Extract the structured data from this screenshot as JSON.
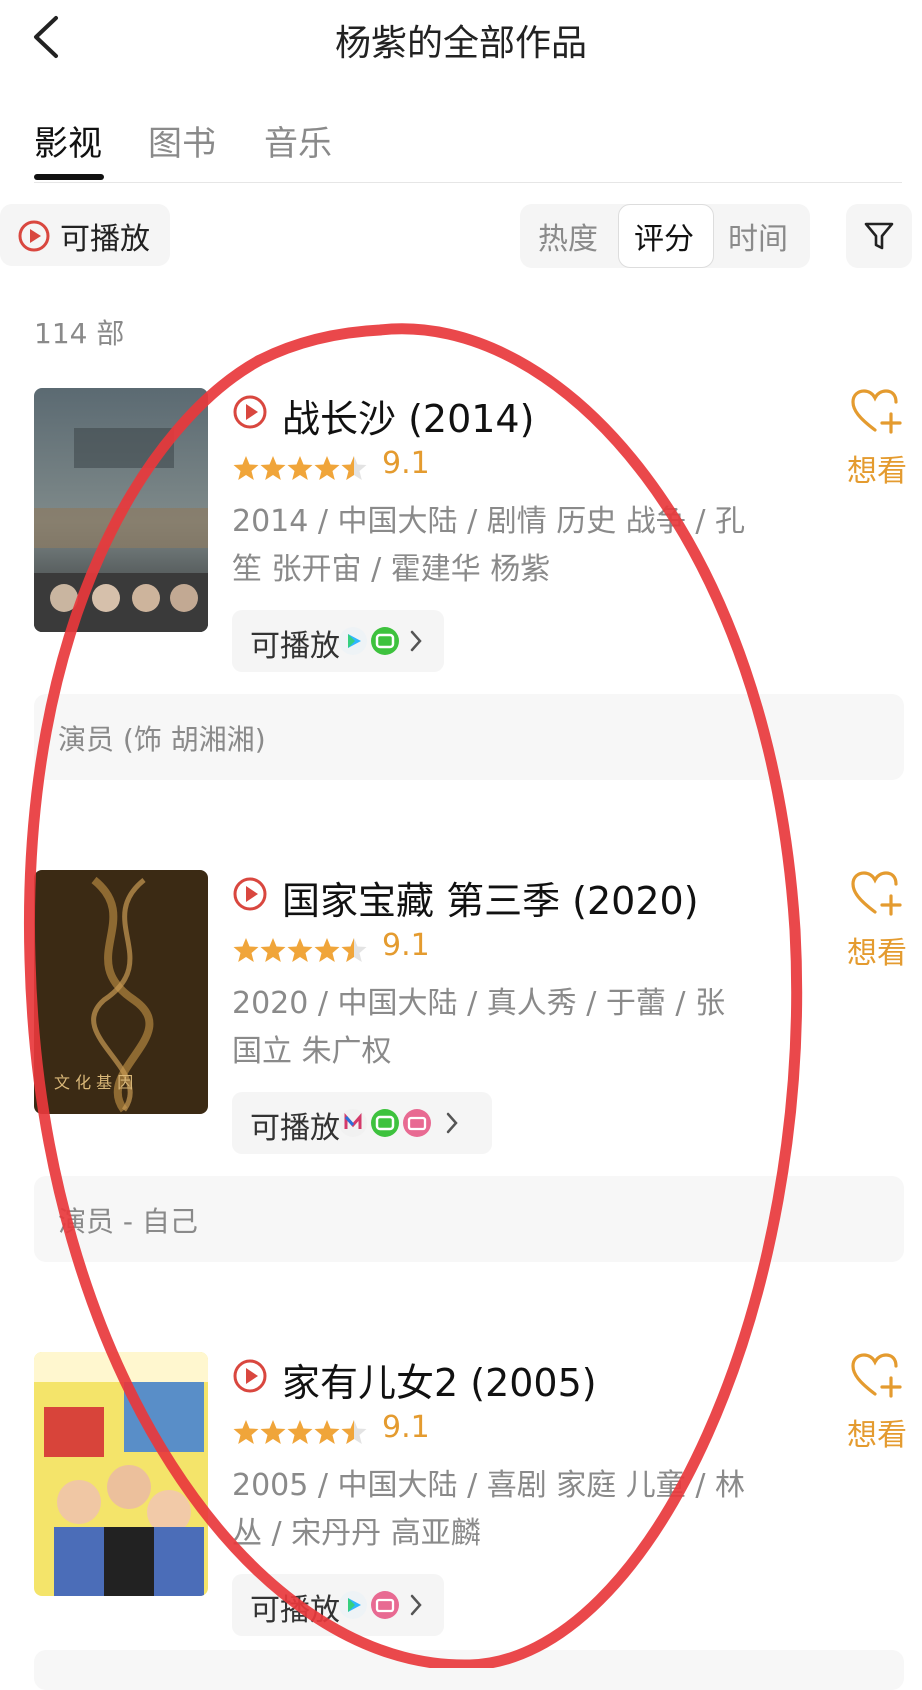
{
  "header": {
    "title": "杨紫的全部作品"
  },
  "tabs": [
    {
      "label": "影视",
      "active": true
    },
    {
      "label": "图书",
      "active": false
    },
    {
      "label": "音乐",
      "active": false
    }
  ],
  "filters": {
    "playable_label": "可播放",
    "sort_options": [
      "热度",
      "评分",
      "时间"
    ],
    "sort_selected": "评分"
  },
  "count_label": "114 部",
  "items": [
    {
      "title": "战长沙 (2014)",
      "rating": "9.1",
      "stars": 4.5,
      "meta": "2014 / 中国大陆 / 剧情 历史 战争 / 孔笙 张开宙 / 霍建华 杨紫",
      "avail_label": "可播放",
      "platforms": [
        "tencent-video-icon",
        "iqiyi-icon"
      ],
      "want_label": "想看",
      "role": "演员 (饰 胡湘湘)"
    },
    {
      "title": "国家宝藏 第三季 (2020)",
      "rating": "9.1",
      "stars": 4.5,
      "meta": "2020 / 中国大陆 / 真人秀 / 于蕾 / 张国立 朱广权",
      "avail_label": "可播放",
      "platforms": [
        "mgtv-icon",
        "iqiyi-icon",
        "bilibili-icon"
      ],
      "want_label": "想看",
      "role": "演员 - 自己"
    },
    {
      "title": "家有儿女2 (2005)",
      "rating": "9.1",
      "stars": 4.5,
      "meta": "2005 / 中国大陆 / 喜剧 家庭 儿童 / 林丛 / 宋丹丹 高亚麟",
      "avail_label": "可播放",
      "platforms": [
        "tencent-video-icon",
        "bilibili-icon"
      ],
      "want_label": "想看",
      "role": ""
    }
  ],
  "colors": {
    "accent": "#e49b2f",
    "play_red": "#d9473f",
    "annotation_red": "#e8383c"
  }
}
